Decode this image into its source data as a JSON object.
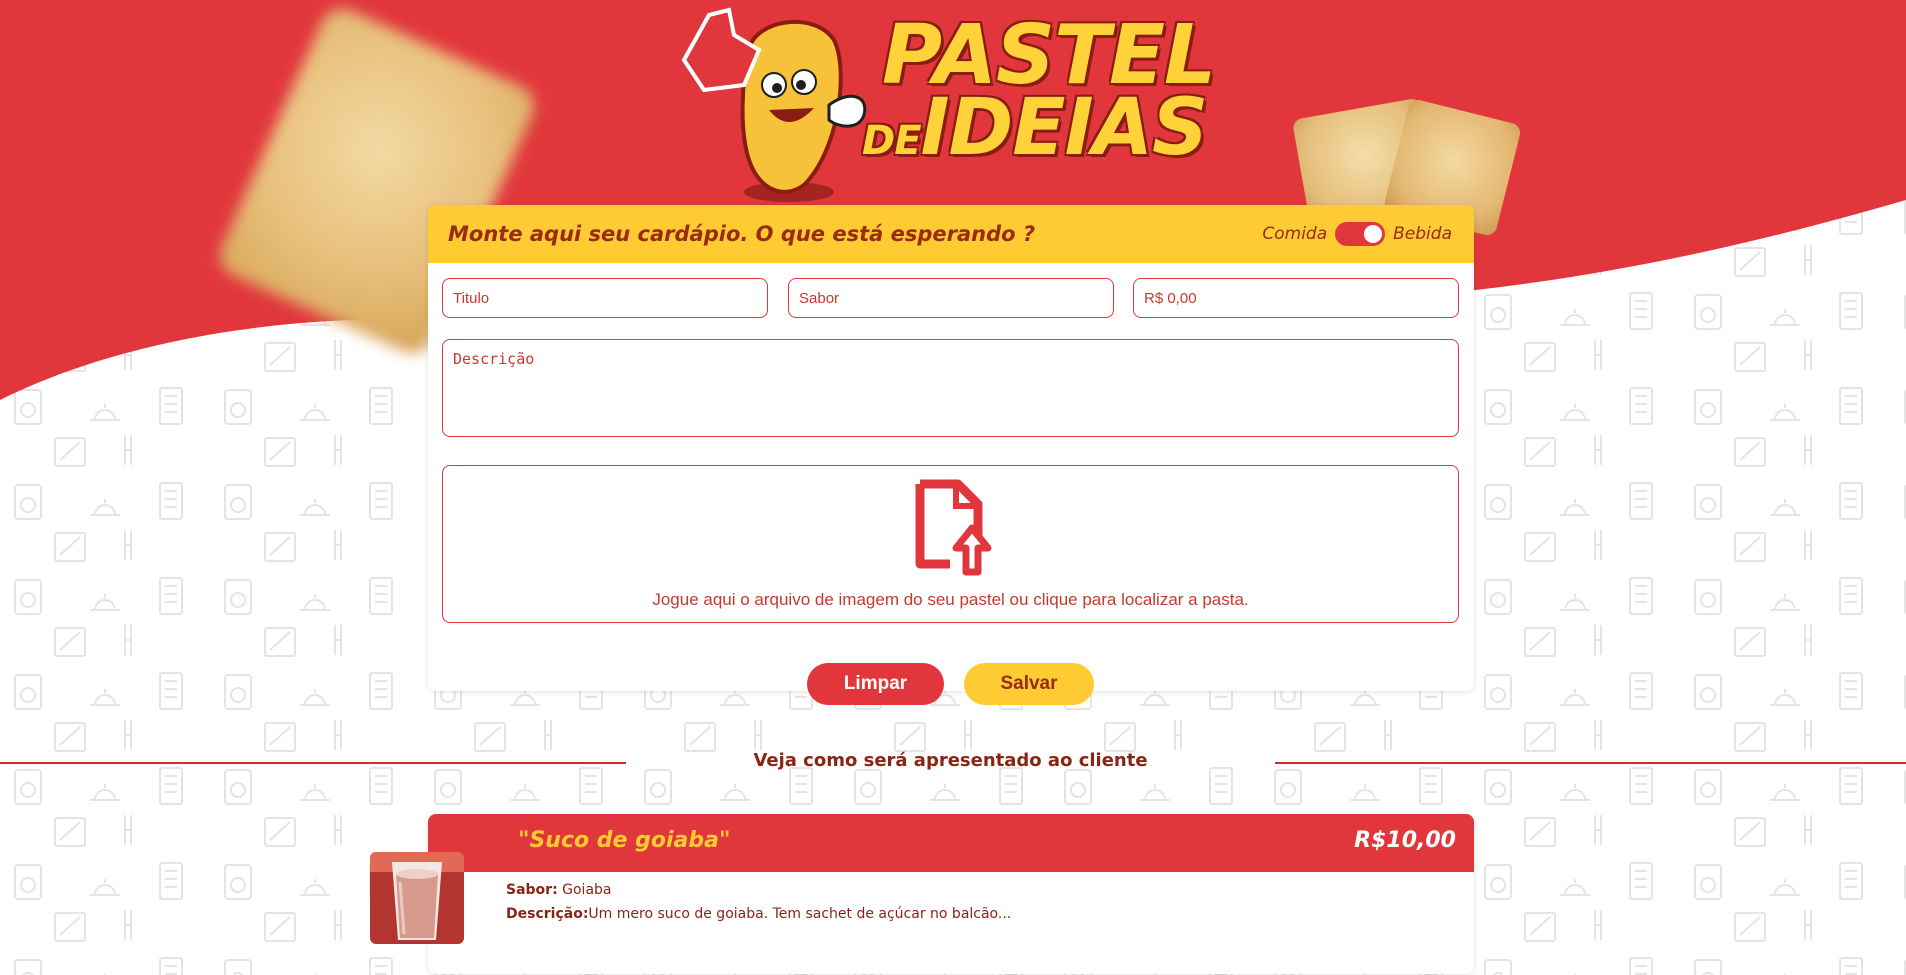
{
  "brand": {
    "logo_line1": "PASTEL",
    "logo_de": "DE",
    "logo_line2": "IDEIAS",
    "colors": {
      "red": "#e1373c",
      "yellow": "#fecb33",
      "dark_red": "#9b2a17"
    }
  },
  "form": {
    "heading": "Monte aqui seu cardápio. O que está esperando ?",
    "toggle_left": "Comida",
    "toggle_right": "Bebida",
    "toggle_state": "Bebida",
    "titulo_placeholder": "Titulo",
    "sabor_placeholder": "Sabor",
    "preco_placeholder": "R$ 0,00",
    "descricao_placeholder": "Descrição",
    "upload_icon": "file-upload-icon",
    "upload_text": "Jogue aqui o arquivo de imagem do seu pastel ou clique para localizar a pasta.",
    "clear_label": "Limpar",
    "save_label": "Salvar"
  },
  "preview": {
    "divider_text": "Veja como será apresentado ao cliente",
    "item": {
      "title": "\"Suco de goiaba\"",
      "price": "R$10,00",
      "flavor_label": "Sabor:",
      "flavor_value": "Goiaba",
      "description_label": "Descrição:",
      "description_value": "Um mero suco de goiaba. Tem sachet de açúcar no balcão..."
    }
  }
}
